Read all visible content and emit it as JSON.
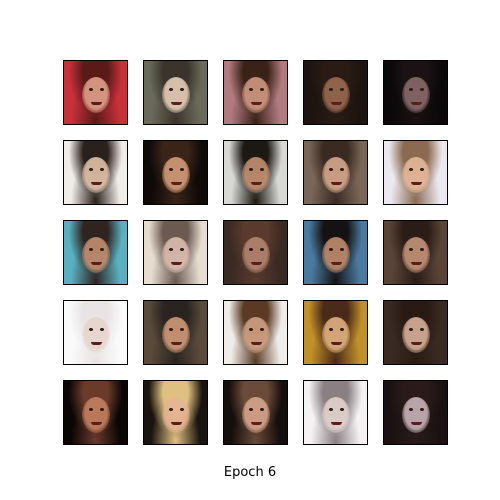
{
  "caption": "Epoch 6",
  "grid": {
    "rows": 5,
    "cols": 5,
    "tiles": [
      {
        "bg": "#c8303a",
        "hair": "#5a1a18",
        "skin": "#e0a08a"
      },
      {
        "bg": "#6a6a5a",
        "hair": "#3a342c",
        "skin": "#e6cdb8"
      },
      {
        "bg": "#b07a80",
        "hair": "#3a2218",
        "skin": "#d09880"
      },
      {
        "bg": "#1c1410",
        "hair": "#2a1c14",
        "skin": "#9a6a50"
      },
      {
        "bg": "#0a0808",
        "hair": "#1a1214",
        "skin": "#8a6a6a"
      },
      {
        "bg": "#f0ece8",
        "hair": "#2a201c",
        "skin": "#e2c2a8"
      },
      {
        "bg": "#0e0a08",
        "hair": "#3a2418",
        "skin": "#d49c7a"
      },
      {
        "bg": "#d8d8d4",
        "hair": "#1c1814",
        "skin": "#c4906e"
      },
      {
        "bg": "#7a6658",
        "hair": "#3a2a22",
        "skin": "#d6a88c"
      },
      {
        "bg": "#ece8f0",
        "hair": "#8a6a50",
        "skin": "#e6b898"
      },
      {
        "bg": "#5ab0c0",
        "hair": "#2e2420",
        "skin": "#c48e70"
      },
      {
        "bg": "#e6dcd0",
        "hair": "#6a5a50",
        "skin": "#dcbcb0"
      },
      {
        "bg": "#3a2a24",
        "hair": "#5a3a2c",
        "skin": "#b48470"
      },
      {
        "bg": "#4a7aa0",
        "hair": "#161214",
        "skin": "#c08c6c"
      },
      {
        "bg": "#5a4438",
        "hair": "#2a1c16",
        "skin": "#c49478"
      },
      {
        "bg": "#fafafa",
        "hair": "#e8e4e4",
        "skin": "#e6d4cc"
      },
      {
        "bg": "#5a4a3a",
        "hair": "#2a2420",
        "skin": "#d09a78"
      },
      {
        "bg": "#f0ece8",
        "hair": "#5a3a24",
        "skin": "#d0a080"
      },
      {
        "bg": "#c0902a",
        "hair": "#4a2a18",
        "skin": "#e0b080"
      },
      {
        "bg": "#3a2a24",
        "hair": "#2a1a14",
        "skin": "#d8b098"
      },
      {
        "bg": "#0a0606",
        "hair": "#6a3a2a",
        "skin": "#c48060"
      },
      {
        "bg": "#1a1410",
        "hair": "#e0c080",
        "skin": "#e6b494"
      },
      {
        "bg": "#140e0c",
        "hair": "#6a4a38",
        "skin": "#d8a48c"
      },
      {
        "bg": "#f4f2f2",
        "hair": "#8a8084",
        "skin": "#e2d2cc"
      },
      {
        "bg": "#1a1212",
        "hair": "#2a1a1a",
        "skin": "#c8b4b8"
      }
    ]
  }
}
